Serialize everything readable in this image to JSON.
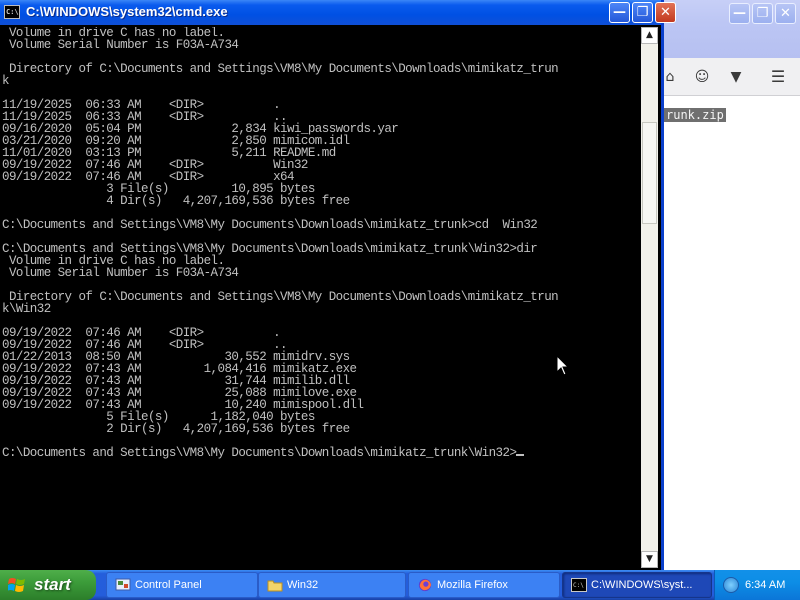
{
  "background_window": {
    "app": "Mozilla Firefox",
    "visible_file_chip": "runk.zip",
    "toolbar_icons": [
      "home-icon",
      "pocket-icon",
      "save-icon",
      "menu-icon"
    ]
  },
  "cmd": {
    "title": "C:\\WINDOWS\\system32\\cmd.exe",
    "icon_text": "C:\\",
    "lines": [
      " Volume in drive C has no label.",
      " Volume Serial Number is F03A-A734",
      "",
      " Directory of C:\\Documents and Settings\\VM8\\My Documents\\Downloads\\mimikatz_trun",
      "k",
      "",
      "11/19/2025  06:33 AM    <DIR>          .",
      "11/19/2025  06:33 AM    <DIR>          ..",
      "09/16/2020  05:04 PM             2,834 kiwi_passwords.yar",
      "03/21/2020  09:20 AM             2,850 mimicom.idl",
      "11/01/2020  03:13 PM             5,211 README.md",
      "09/19/2022  07:46 AM    <DIR>          Win32",
      "09/19/2022  07:46 AM    <DIR>          x64",
      "               3 File(s)         10,895 bytes",
      "               4 Dir(s)   4,207,169,536 bytes free",
      "",
      "C:\\Documents and Settings\\VM8\\My Documents\\Downloads\\mimikatz_trunk>cd  Win32",
      "",
      "C:\\Documents and Settings\\VM8\\My Documents\\Downloads\\mimikatz_trunk\\Win32>dir",
      " Volume in drive C has no label.",
      " Volume Serial Number is F03A-A734",
      "",
      " Directory of C:\\Documents and Settings\\VM8\\My Documents\\Downloads\\mimikatz_trun",
      "k\\Win32",
      "",
      "09/19/2022  07:46 AM    <DIR>          .",
      "09/19/2022  07:46 AM    <DIR>          ..",
      "01/22/2013  08:50 AM            30,552 mimidrv.sys",
      "09/19/2022  07:43 AM         1,084,416 mimikatz.exe",
      "09/19/2022  07:43 AM            31,744 mimilib.dll",
      "09/19/2022  07:43 AM            25,088 mimilove.exe",
      "09/19/2022  07:43 AM            10,240 mimispool.dll",
      "               5 File(s)      1,182,040 bytes",
      "               2 Dir(s)   4,207,169,536 bytes free",
      "",
      "C:\\Documents and Settings\\VM8\\My Documents\\Downloads\\mimikatz_trunk\\Win32>"
    ]
  },
  "taskbar": {
    "start_label": "start",
    "tasks": [
      {
        "label": "Control Panel",
        "icon": "control-panel-icon",
        "active": false
      },
      {
        "label": "Win32",
        "icon": "folder-icon",
        "active": false
      },
      {
        "label": "Mozilla Firefox",
        "icon": "firefox-icon",
        "active": false
      },
      {
        "label": "C:\\WINDOWS\\syst...",
        "icon": "cmd-icon",
        "active": true
      }
    ],
    "clock": "6:34 AM"
  }
}
